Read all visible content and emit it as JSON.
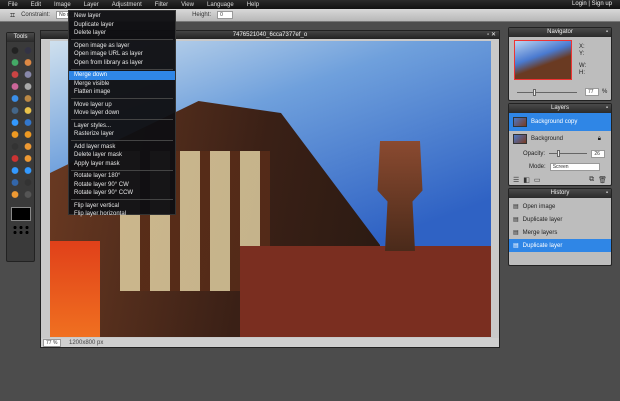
{
  "menubar": {
    "items": [
      "File",
      "Edit",
      "Image",
      "Layer",
      "Adjustment",
      "Filter",
      "View",
      "Language",
      "Help"
    ],
    "login": "Login",
    "signup": "Sign up"
  },
  "toolbar": {
    "constraint_label": "Constraint:",
    "constraint_value": "No restriction",
    "height_label": "Height:",
    "height_value": "0"
  },
  "tools": {
    "title": "Tools"
  },
  "layer_menu": {
    "items": [
      [
        "New layer",
        "Duplicate layer",
        "Delete layer"
      ],
      [
        "Open image as layer",
        "Open image URL as layer",
        "Open from library as layer"
      ],
      [
        "Merge down",
        "Merge visible",
        "Flatten image"
      ],
      [
        "Move layer up",
        "Move layer down"
      ],
      [
        "Layer styles...",
        "Rasterize layer"
      ],
      [
        "Add layer mask",
        "Delete layer mask",
        "Apply layer mask"
      ],
      [
        "Rotate layer 180°",
        "Rotate layer 90° CW",
        "Rotate layer 90° CCW"
      ],
      [
        "Flip layer vertical",
        "Flip layer horizontal"
      ]
    ],
    "highlighted": "Merge down"
  },
  "image_window": {
    "title": "7476521040_6cca7377ef_o",
    "zoom": "77",
    "zoom_unit": "%",
    "dimensions": "1200x800 px"
  },
  "navigator": {
    "title": "Navigator",
    "x_label": "X:",
    "y_label": "Y:",
    "w_label": "W:",
    "h_label": "H:",
    "zoom": "77",
    "zoom_unit": "%"
  },
  "layers": {
    "title": "Layers",
    "items": [
      {
        "name": "Background copy",
        "selected": true
      },
      {
        "name": "Background",
        "selected": false
      }
    ],
    "opacity_label": "Opacity:",
    "opacity_value": "26",
    "mode_label": "Mode:",
    "mode_value": "Screen"
  },
  "history": {
    "title": "History",
    "items": [
      "Open image",
      "Duplicate layer",
      "Merge layers",
      "Duplicate layer"
    ],
    "selected_index": 3
  },
  "colors": {
    "accent": "#2f86e6",
    "background": "#4c4c4c"
  }
}
